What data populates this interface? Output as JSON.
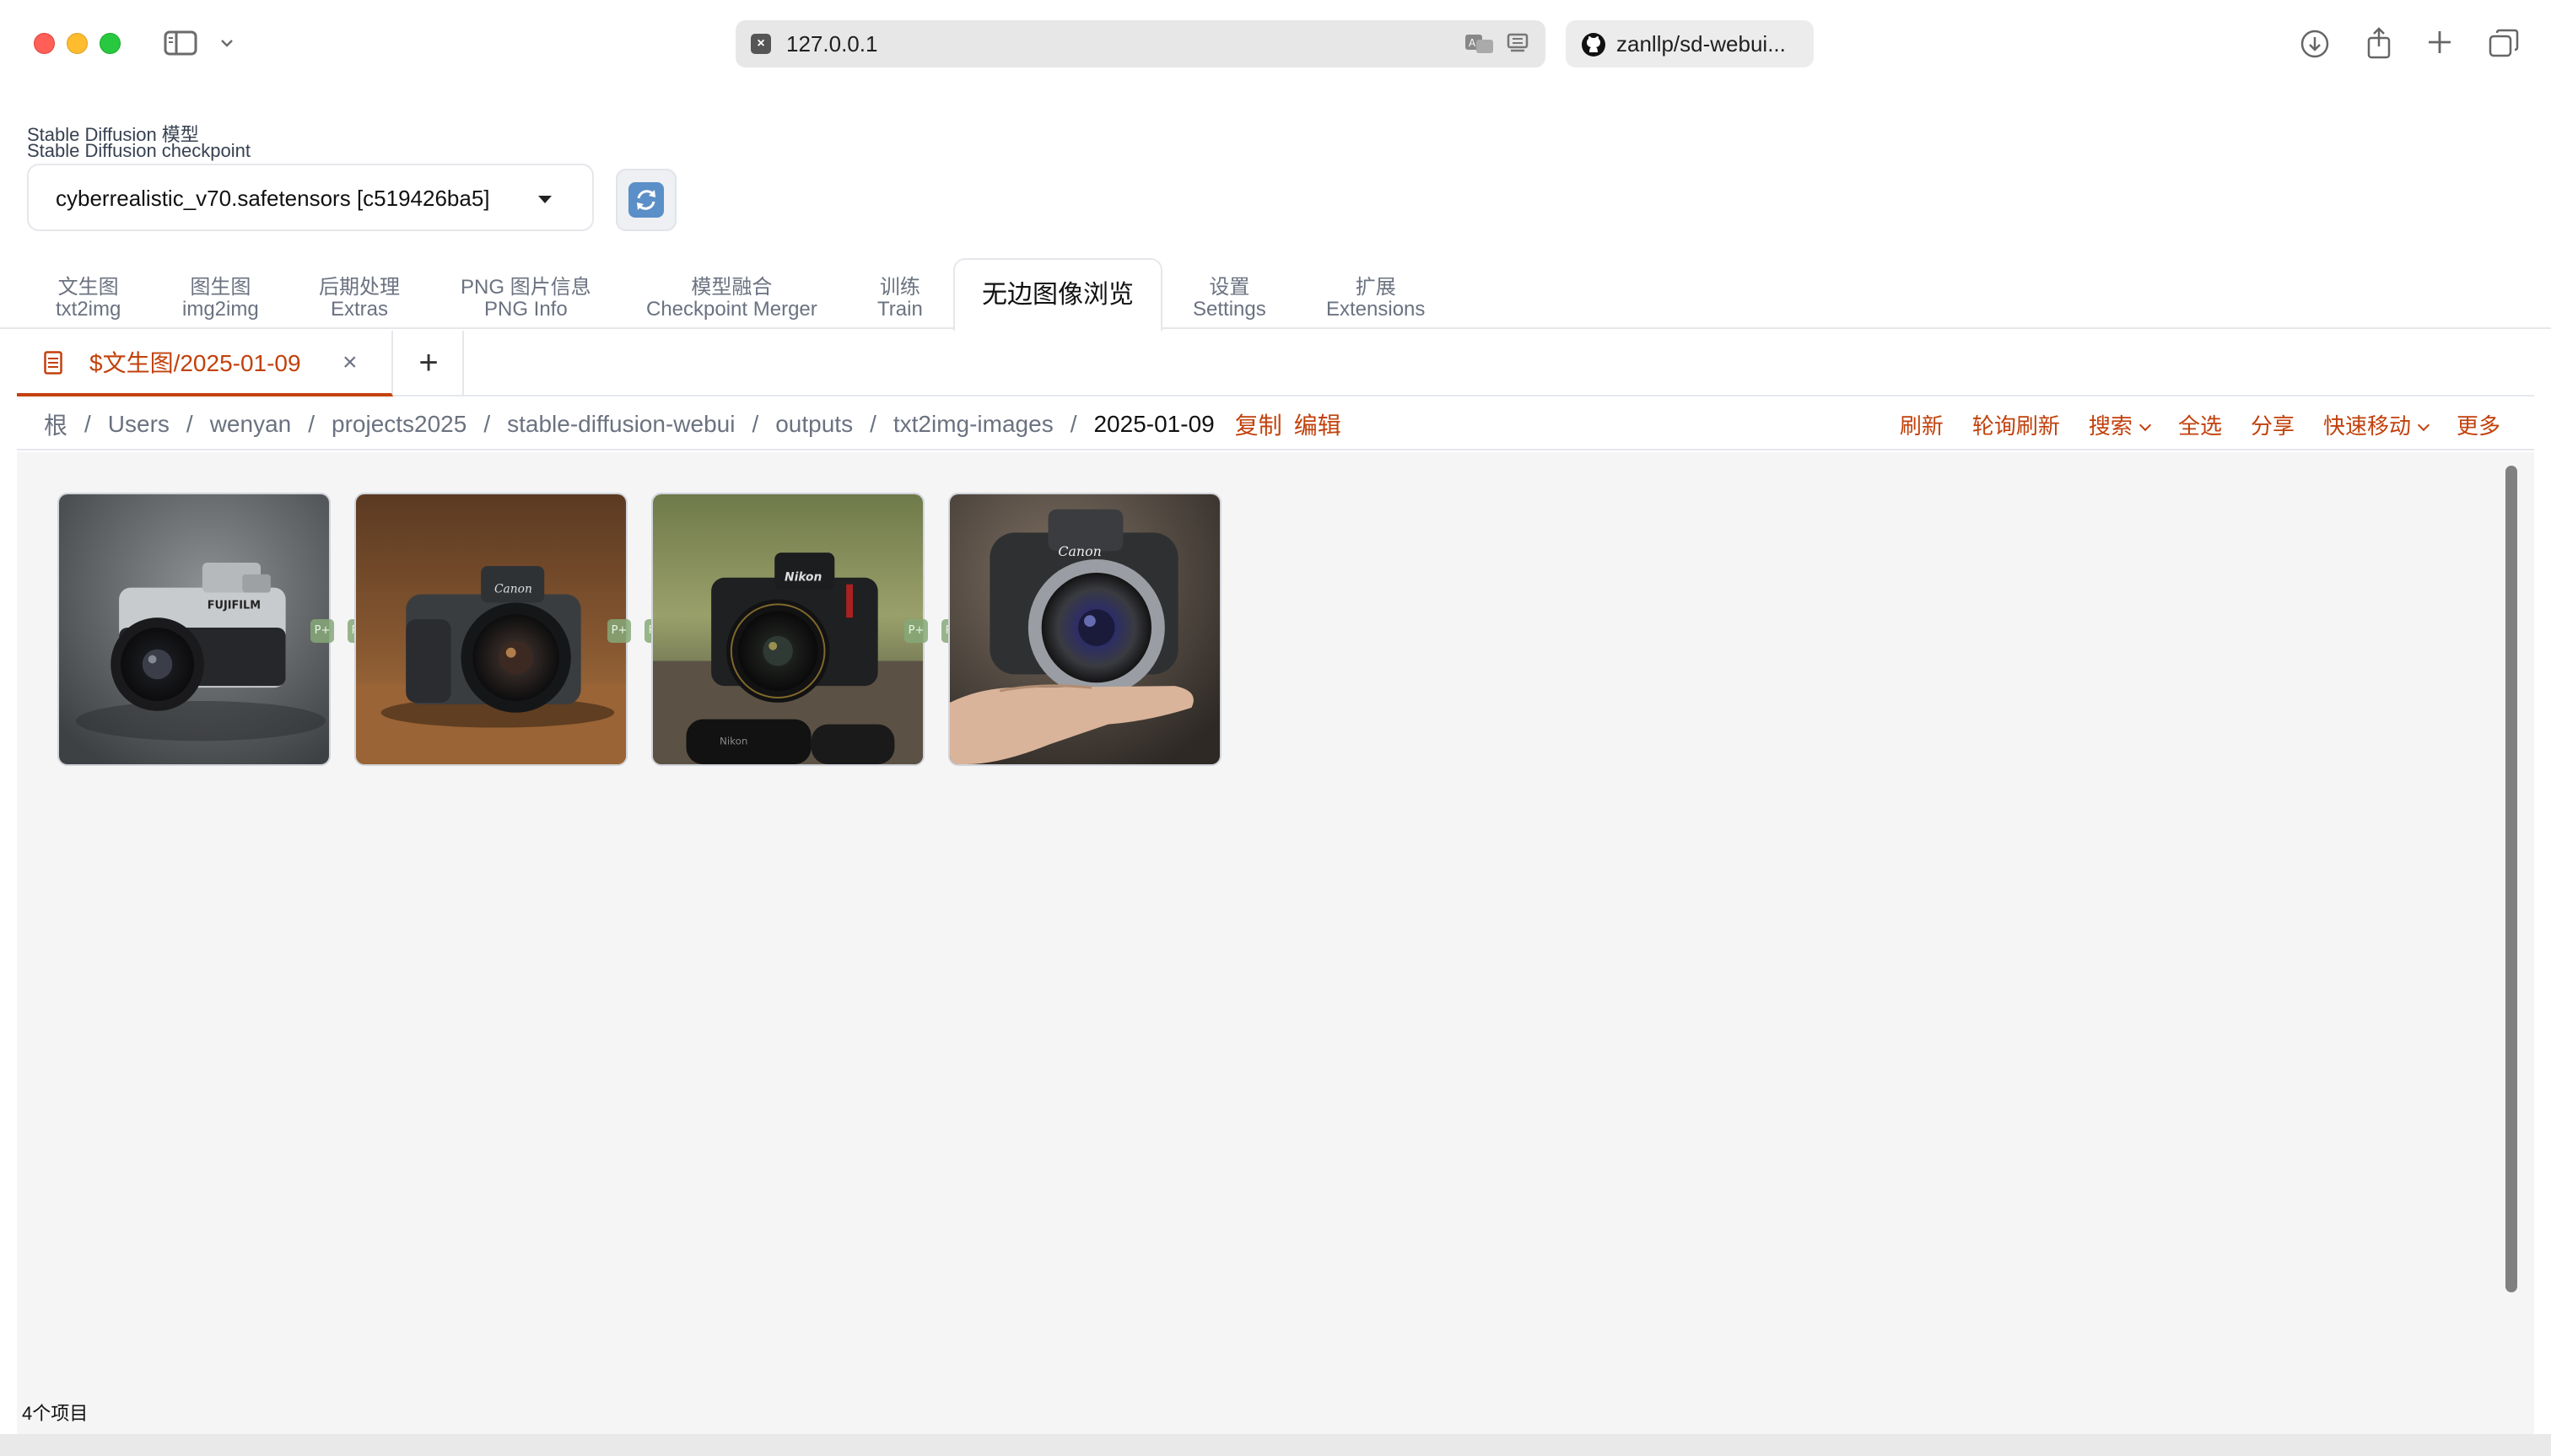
{
  "browser": {
    "url": "127.0.0.1",
    "second_tab_title": "zanllp/sd-webui..."
  },
  "checkpoint": {
    "label_cn": "Stable Diffusion 模型",
    "label_en": "Stable Diffusion checkpoint",
    "selected": "cyberrealistic_v70.safetensors [c519426ba5]"
  },
  "main_tabs": [
    {
      "cn": "文生图",
      "en": "txt2img"
    },
    {
      "cn": "图生图",
      "en": "img2img"
    },
    {
      "cn": "后期处理",
      "en": "Extras"
    },
    {
      "cn": "PNG 图片信息",
      "en": "PNG Info"
    },
    {
      "cn": "模型融合",
      "en": "Checkpoint Merger"
    },
    {
      "cn": "训练",
      "en": "Train"
    },
    {
      "label": "无边图像浏览"
    },
    {
      "cn": "设置",
      "en": "Settings"
    },
    {
      "cn": "扩展",
      "en": "Extensions"
    }
  ],
  "inner_tab": {
    "label": "$文生图/2025-01-09",
    "close": "×",
    "add": "+"
  },
  "breadcrumb": {
    "parts": [
      "根",
      "Users",
      "wenyan",
      "projects2025",
      "stable-diffusion-webui",
      "outputs",
      "txt2img-images"
    ],
    "current": "2025-01-09",
    "copy": "复制",
    "edit": "编辑"
  },
  "actions": {
    "refresh": "刷新",
    "poll_refresh": "轮询刷新",
    "search": "搜索",
    "select_all": "全选",
    "share": "分享",
    "quick_move": "快速移动",
    "more": "更多"
  },
  "gallery": {
    "items": [
      {
        "name": "camera-fujifilm",
        "brand": "FUJIFILM"
      },
      {
        "name": "camera-canon-1",
        "brand": "Canon"
      },
      {
        "name": "camera-nikon",
        "brand": "Nikon"
      },
      {
        "name": "camera-canon-hand",
        "brand": "Canon"
      }
    ],
    "badge": "P+",
    "count_text": "4个项目"
  },
  "colors": {
    "accent": "#c2410c",
    "gallery_bg": "#f5f5f5"
  }
}
